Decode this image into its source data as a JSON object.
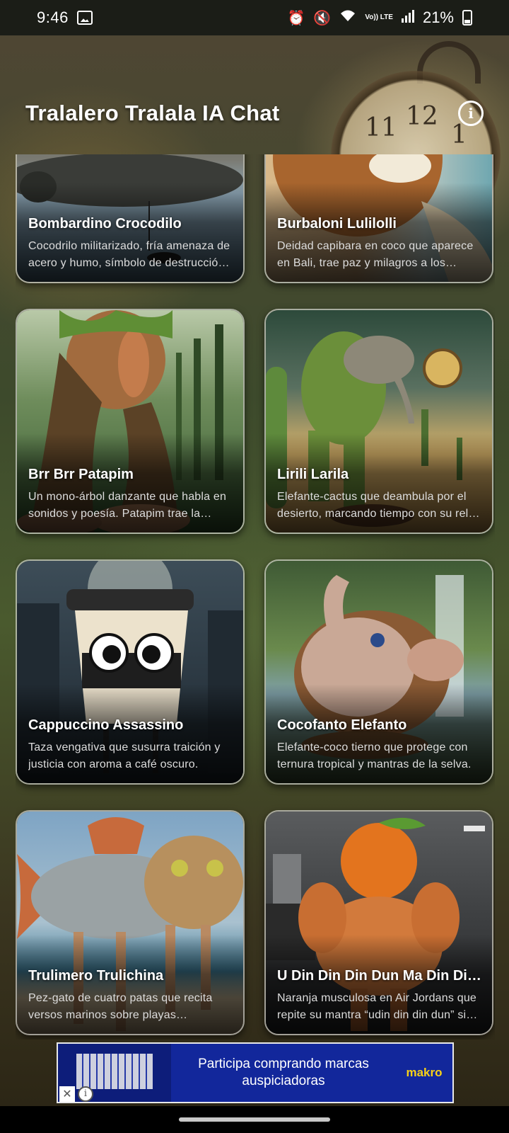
{
  "status_bar": {
    "time": "9:46",
    "battery_percent": "21%",
    "icons": [
      "image-icon",
      "alarm-icon",
      "mute-icon",
      "wifi-icon",
      "volte-lte-icon",
      "signal-icon",
      "battery-icon"
    ],
    "volte_label": "Vo)) LTE"
  },
  "header": {
    "title": "Tralalero Tralala IA Chat",
    "info_icon": "info-icon"
  },
  "cards": [
    {
      "title": "Bombardino Crocodilo",
      "description": "Cocodrilo militarizado, fría amenaza de acero y humo, símbolo de destrucción en los cielos."
    },
    {
      "title": "Burbaloni Lulilolli",
      "description": "Deidad capibara en coco que aparece en Bali, trae paz y milagros a los pescadores."
    },
    {
      "title": "Brr Brr Patapim",
      "description": "Un mono-árbol danzante que habla en sonidos y poesía. Patapim trae la música del bosque."
    },
    {
      "title": "Lirili Larila",
      "description": "Elefante-cactus que deambula por el desierto, marcando tiempo con su reloj mágico."
    },
    {
      "title": "Cappuccino Assassino",
      "description": "Taza vengativa que susurra traición y justicia con aroma a café oscuro."
    },
    {
      "title": "Cocofanto Elefanto",
      "description": "Elefante-coco tierno que protege con ternura tropical y mantras de la selva."
    },
    {
      "title": "Trulimero Trulichina",
      "description": "Pez-gato de cuatro patas que recita versos marinos sobre playas bombardeadas."
    },
    {
      "title": "U Din Din Din Dun Ma Din Din Din Dun",
      "description": "Naranja musculosa en Air Jordans que repite su mantra “udin din din dun” sin parar."
    }
  ],
  "ad": {
    "text": "Participa comprando marcas auspiciadoras",
    "brand": "makro",
    "close_label": "✕",
    "info_label": "i"
  },
  "colors": {
    "status_bar": "#1b1d17",
    "ad_background": "#12279b",
    "ad_brand": "#f7d117"
  }
}
